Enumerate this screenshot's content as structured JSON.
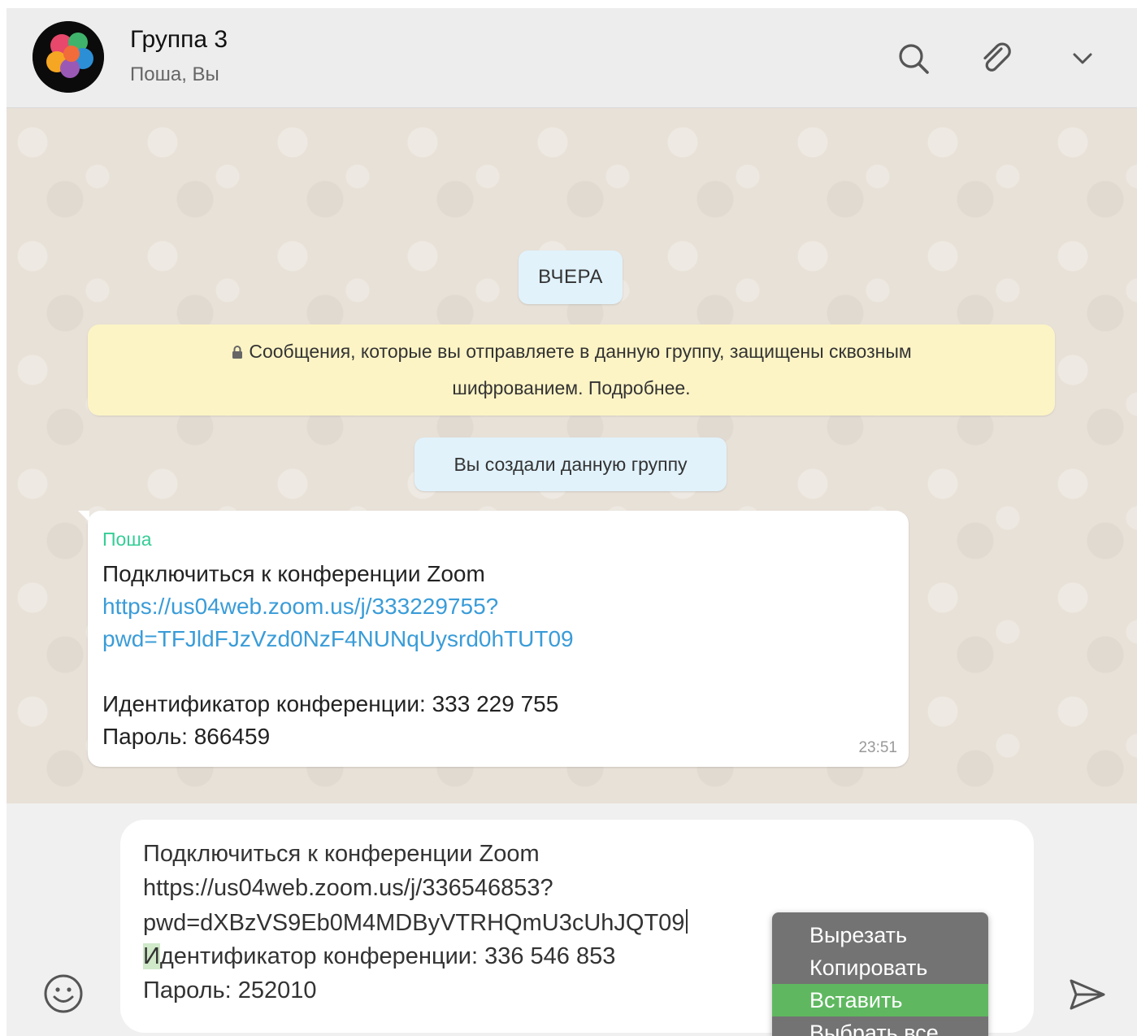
{
  "header": {
    "title": "Группа 3",
    "subtitle": "Поша, Вы",
    "icons": [
      "search-icon",
      "paperclip-icon",
      "chevron-down-icon"
    ]
  },
  "chat": {
    "date_label": "ВЧЕРА",
    "encryption_notice_line1": "Сообщения, которые вы отправляете в данную группу, защищены сквозным",
    "encryption_notice_line2": "шифрованием. Подробнее.",
    "system_message": "Вы создали данную группу",
    "message": {
      "sender": "Поша",
      "line1": "Подключиться к конференции Zoom",
      "link_line1": "https://us04web.zoom.us/j/333229755?",
      "link_line2": "pwd=TFJldFJzVzd0NzF4NUNqUysrd0hTUT09",
      "meeting_id": "Идентификатор конференции: 333 229 755",
      "password": "Пароль: 866459",
      "time": "23:51"
    }
  },
  "composer": {
    "line1": "Подключиться к конференции Zoom",
    "line2": "https://us04web.zoom.us/j/336546853?",
    "line3": "pwd=dXBzVS9Eb0M4MDByVTRHQmU3cUhJQT09",
    "line4_first": "И",
    "line4_rest": "дентификатор конференции: 336 546 853",
    "line5": "Пароль: 252010"
  },
  "context_menu": {
    "items": [
      "Вырезать",
      "Копировать",
      "Вставить",
      "Выбрать все"
    ],
    "highlighted": "Вставить"
  },
  "colors": {
    "sender": "#35cd96",
    "link": "#3a9cd8",
    "menu_highlight": "#5fb860",
    "banner": "#fdf4c5",
    "pill": "#e1f2fb"
  }
}
